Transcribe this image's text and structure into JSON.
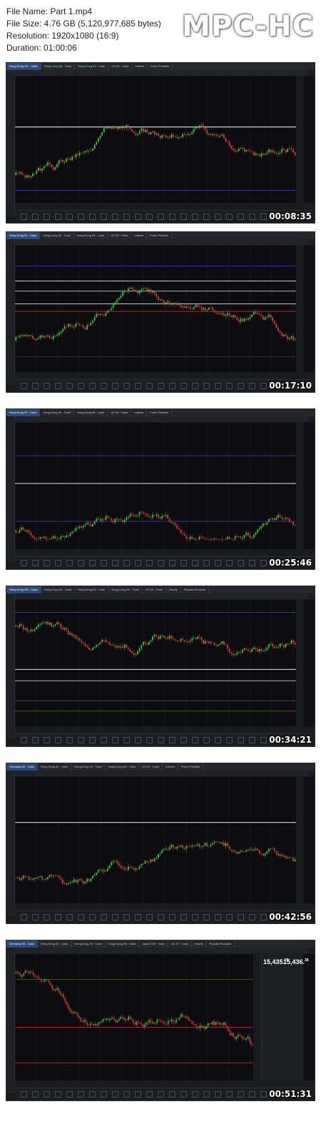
{
  "file_info": {
    "name_line": "File Name: Part 1.mp4",
    "size_line": "File Size: 4.76 GB (5,120,977,685 bytes)",
    "resolution_line": "Resolution: 1920x1080 (16:9)",
    "duration_line": "Duration: 01:00:06"
  },
  "logo": "MPC-HC",
  "colors": {
    "chart_bg": "#0c0c10",
    "up_candle": "#3fbf3f",
    "down_candle": "#d43a3a",
    "hline_white": "#e8e8e8",
    "hline_blue": "#3a5fd9",
    "hline_red": "#c0392b"
  },
  "thumbnails": [
    {
      "timestamp": "00:08:35",
      "tabs": [
        "Hong Kong HS · Cash",
        "Hong Kong 50 · Cash",
        "Hong Kong 50 · Cash",
        "US 30 · Cash",
        "Indices",
        "Forex Portfolio"
      ]
    },
    {
      "timestamp": "00:17:10",
      "tabs": [
        "Hong Kong 50 · Cash",
        "Hong Kong 50 · Cash",
        "Hong Kong 50 · Cash",
        "US 30 · Cash",
        "Indices",
        "Forex Portfolio"
      ]
    },
    {
      "timestamp": "00:25:46",
      "tabs": [
        "Hong Kong 50 · Cash",
        "Hong Kong 50 · Cash",
        "Hong Kong 50 · Cash",
        "US 30 · Cash",
        "Indices",
        "Forex Portfolio"
      ]
    },
    {
      "timestamp": "00:34:21",
      "tabs": [
        "Hong Kong HS · Cash",
        "Hong Kong 50 · Cash",
        "Hong Kong 50 · Cash",
        "Hong Kong 50 · Cash",
        "US 30 · Cash",
        "Hourly",
        "Popular Products"
      ]
    },
    {
      "timestamp": "00:42:56",
      "tabs": [
        "Germany 30 · Cash",
        "Hong Kong 50 · Cash",
        "Hong Kong 50 · Cash",
        "Hong Kong 50 · Cash",
        "US 30 · Cash",
        "Indices",
        "Forex Portfolio"
      ]
    },
    {
      "timestamp": "00:51:31",
      "tabs": [
        "Germany 30 · Cash",
        "Hong Kong 50 · Cash",
        "Hong Kong 50 · Cash",
        "Hong Kong 50 · Cash",
        "Japan 225 · Cash",
        "US 30 · Cash",
        "Hourly",
        "Popular Products"
      ],
      "side_panel": {
        "sell": "15,435.",
        "sell_sup": "78",
        "buy": "15,436.",
        "buy_sup": "38"
      }
    }
  ]
}
